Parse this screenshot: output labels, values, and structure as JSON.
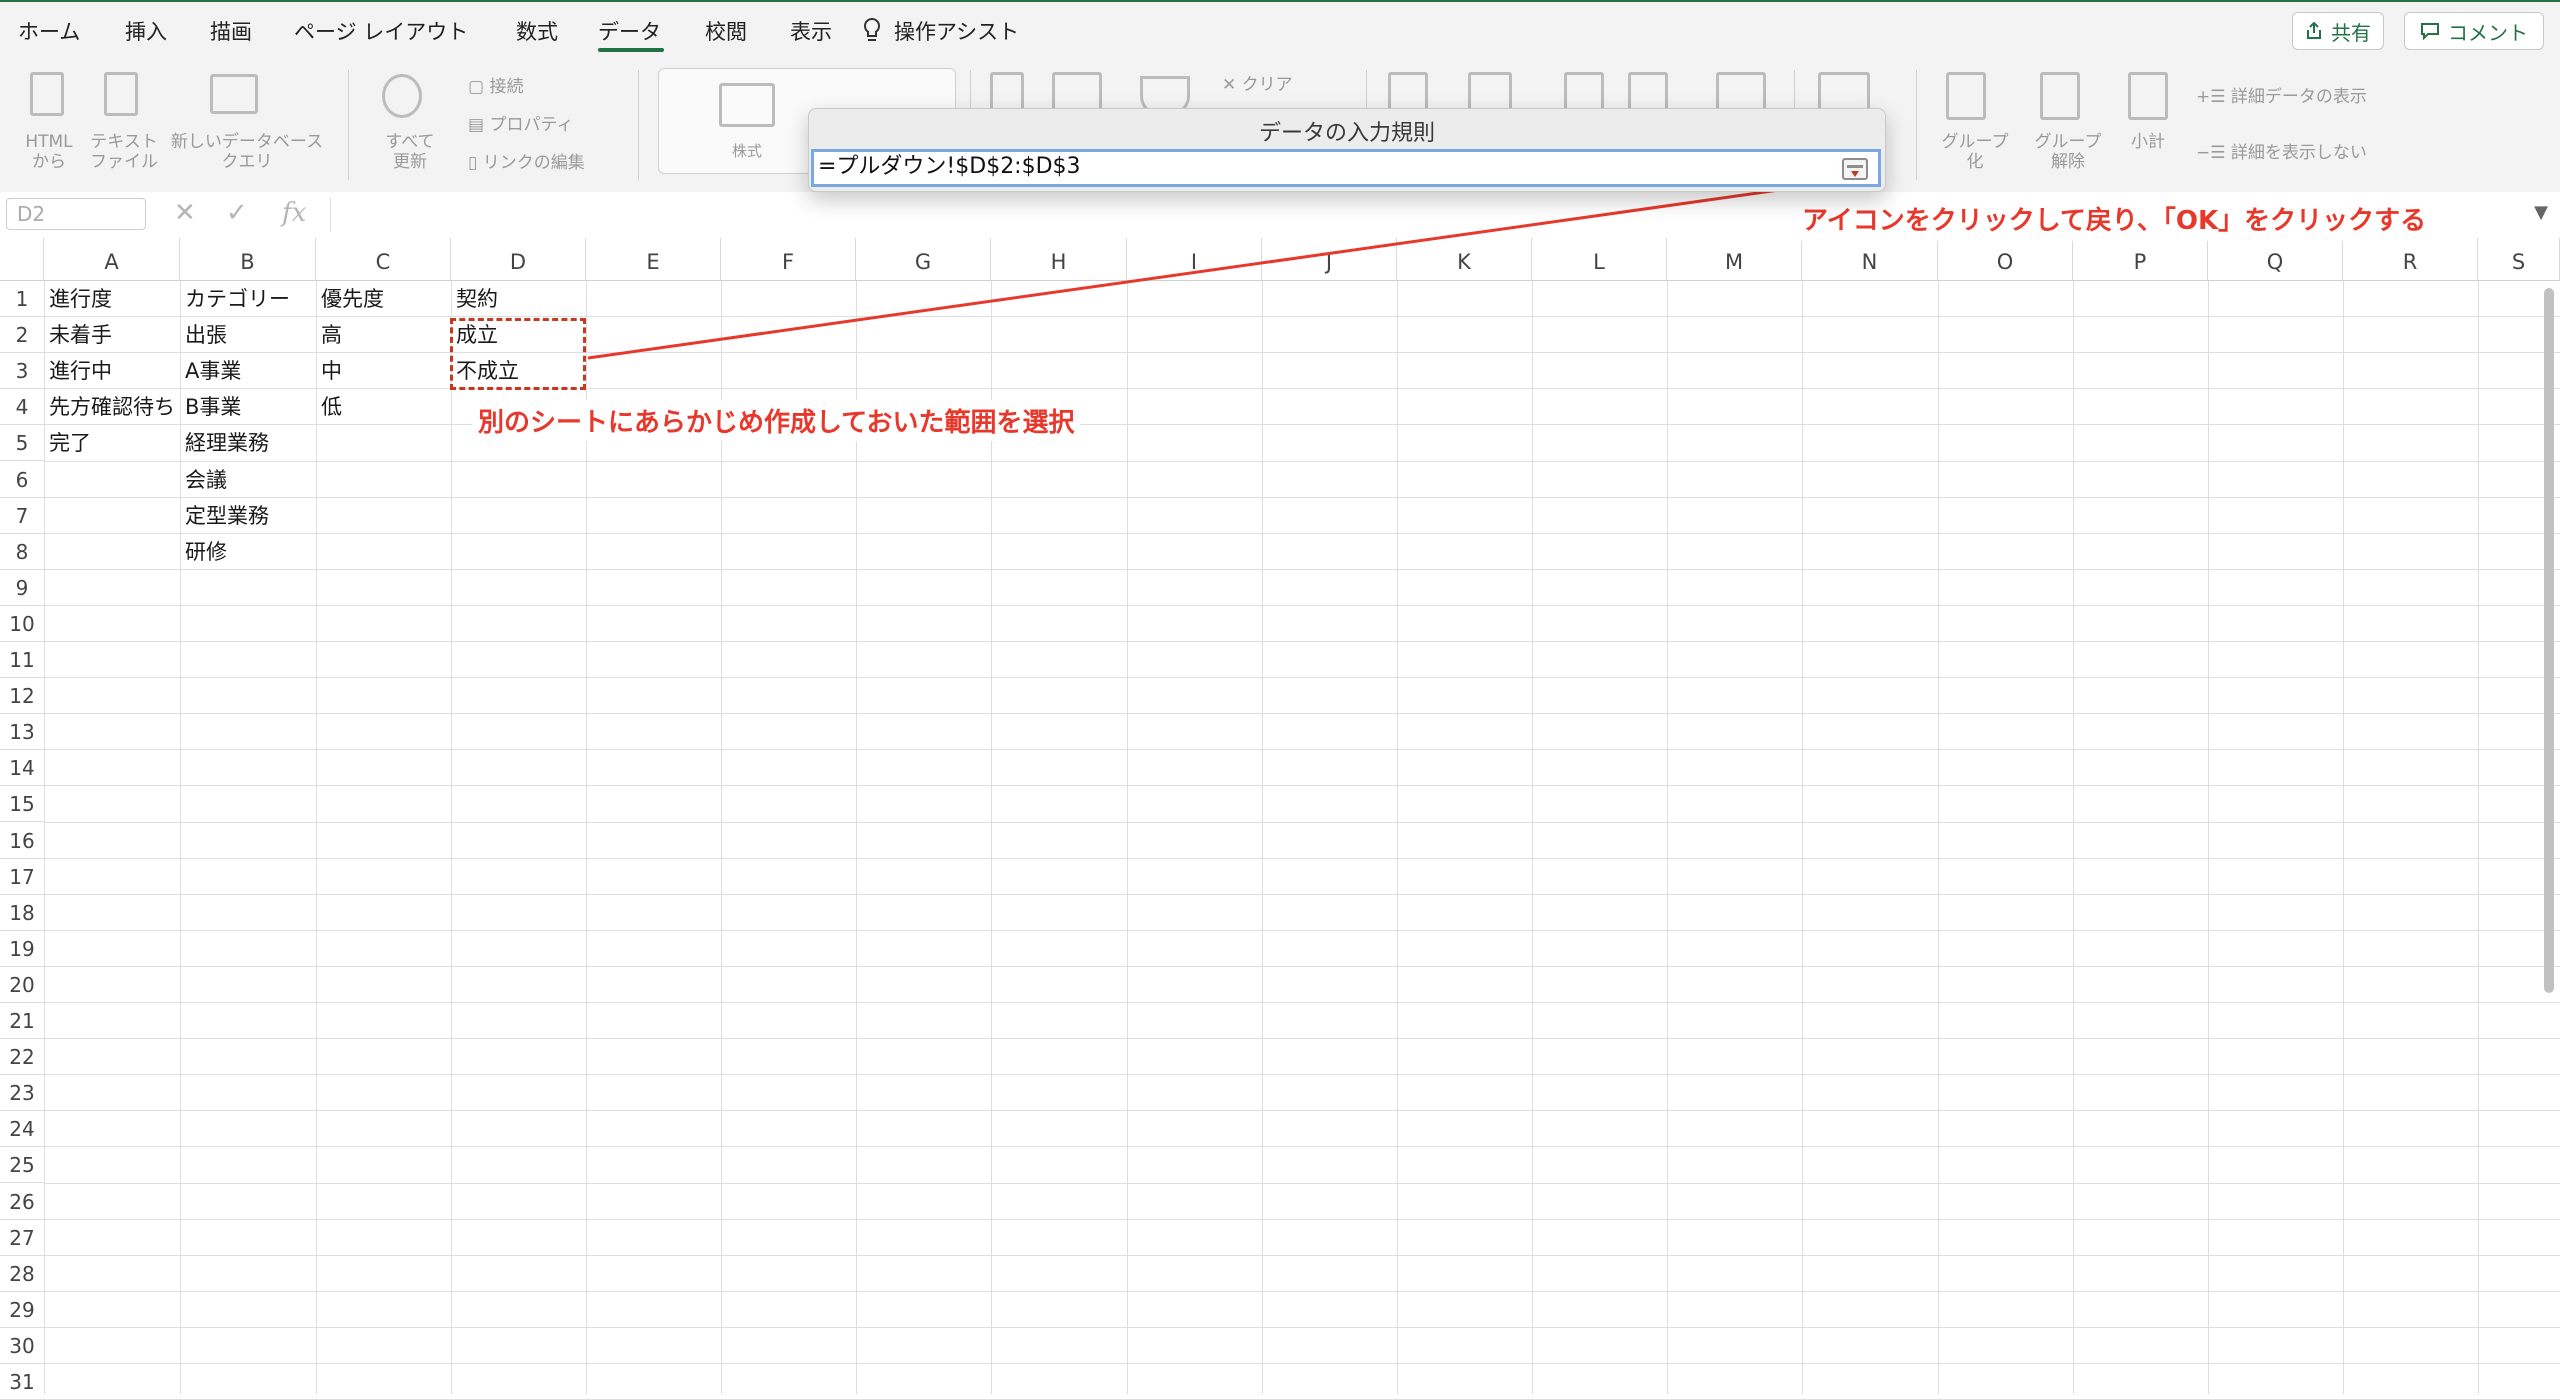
{
  "tabs": [
    "ホーム",
    "挿入",
    "描画",
    "ページ レイアウト",
    "数式",
    "データ",
    "校閲",
    "表示"
  ],
  "active_tab": "データ",
  "assist_label": "操作アシスト",
  "share_label": "共有",
  "comment_label": "コメント",
  "ribbon": {
    "html_from_line1": "HTML",
    "html_from_line2": "から",
    "text_file_line1": "テキスト",
    "text_file_line2": "ファイル",
    "new_query_line1": "新しいデータベース",
    "new_query_line2": "クエリ",
    "refresh_line1": "すべて",
    "refresh_line2": "更新",
    "connections": "接続",
    "properties": "プロパティ",
    "edit_links": "リンクの編集",
    "stocks": "株式",
    "clear": "クリア",
    "group_line1": "グループ",
    "group_line2": "化",
    "ungroup_line1": "グループ",
    "ungroup_line2": "解除",
    "subtotal": "小計",
    "show_detail": "詳細データの表示",
    "hide_detail": "詳細を表示しない"
  },
  "formula_bar": {
    "name_box": "D2",
    "fx": "fx"
  },
  "dialog": {
    "title": "データの入力規則",
    "input_value": "=プルダウン!$D$2:$D$3"
  },
  "columns": [
    "A",
    "B",
    "C",
    "D",
    "E",
    "F",
    "G",
    "H",
    "I",
    "J",
    "K",
    "L",
    "M",
    "N",
    "O",
    "P",
    "Q",
    "R",
    "S"
  ],
  "rows": [
    "1",
    "2",
    "3",
    "4",
    "5",
    "6",
    "7",
    "8",
    "9",
    "10",
    "11",
    "12",
    "13",
    "14",
    "15",
    "16",
    "17",
    "18",
    "19",
    "20",
    "21",
    "22",
    "23",
    "24",
    "25",
    "26",
    "27",
    "28",
    "29",
    "30",
    "31"
  ],
  "cells": {
    "A1": "進行度",
    "B1": "カテゴリー",
    "C1": "優先度",
    "D1": "契約",
    "A2": "未着手",
    "B2": "出張",
    "C2": "高",
    "D2": "成立",
    "A3": "進行中",
    "B3": "A事業",
    "C3": "中",
    "D3": "不成立",
    "A4": "先方確認待ち",
    "B4": "B事業",
    "C4": "低",
    "A5": "完了",
    "B5": "経理業務",
    "B6": "会議",
    "B7": "定型業務",
    "B8": "研修"
  },
  "annotations": {
    "top": "アイコンをクリックして戻り、「OK」をクリックする",
    "middle": "別のシートにあらかじめ作成しておいた範囲を選択"
  },
  "colors": {
    "accent": "#217346",
    "annotation": "#e8382c"
  }
}
